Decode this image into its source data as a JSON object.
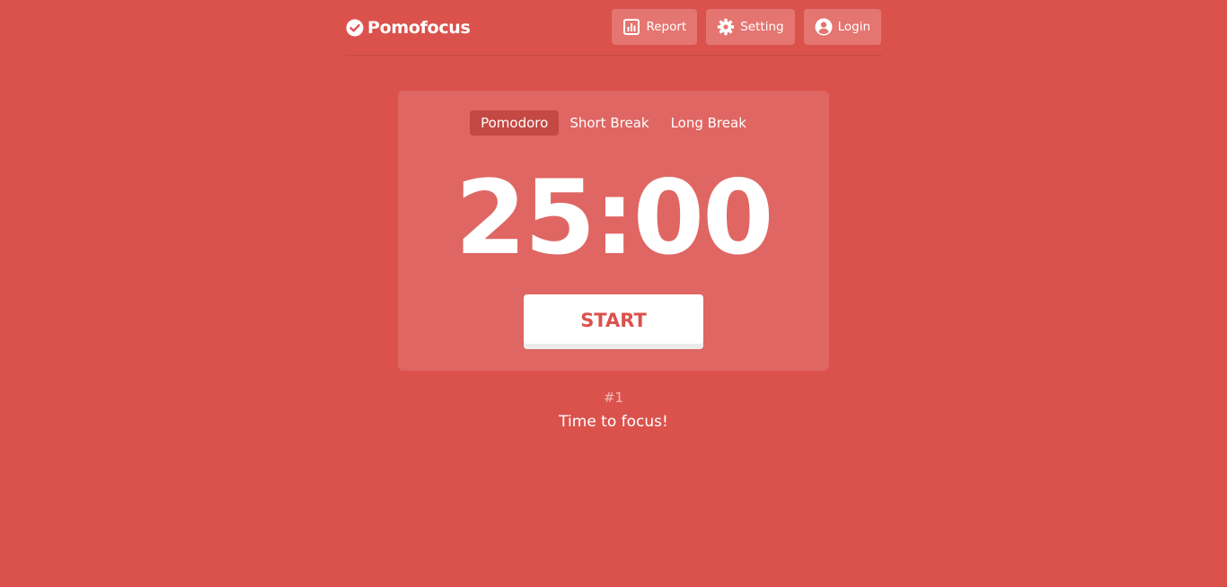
{
  "colors": {
    "background": "#db524d",
    "card": "#df6662",
    "nav_button": "#e47571",
    "tab_active": "#c44843",
    "start_text": "#db524d",
    "start_shadow": "#ebebeb"
  },
  "header": {
    "brand_icon": "check-circle-icon",
    "brand_name": "Pomofocus",
    "nav": [
      {
        "label": "Report",
        "icon": "chart-icon"
      },
      {
        "label": "Setting",
        "icon": "gear-icon"
      },
      {
        "label": "Login",
        "icon": "user-circle-icon"
      }
    ]
  },
  "timer": {
    "tabs": [
      {
        "label": "Pomodoro",
        "active": true
      },
      {
        "label": "Short Break",
        "active": false
      },
      {
        "label": "Long Break",
        "active": false
      }
    ],
    "time": "25:00",
    "start_label": "START"
  },
  "session": {
    "count": "#1",
    "message": "Time to focus!"
  }
}
